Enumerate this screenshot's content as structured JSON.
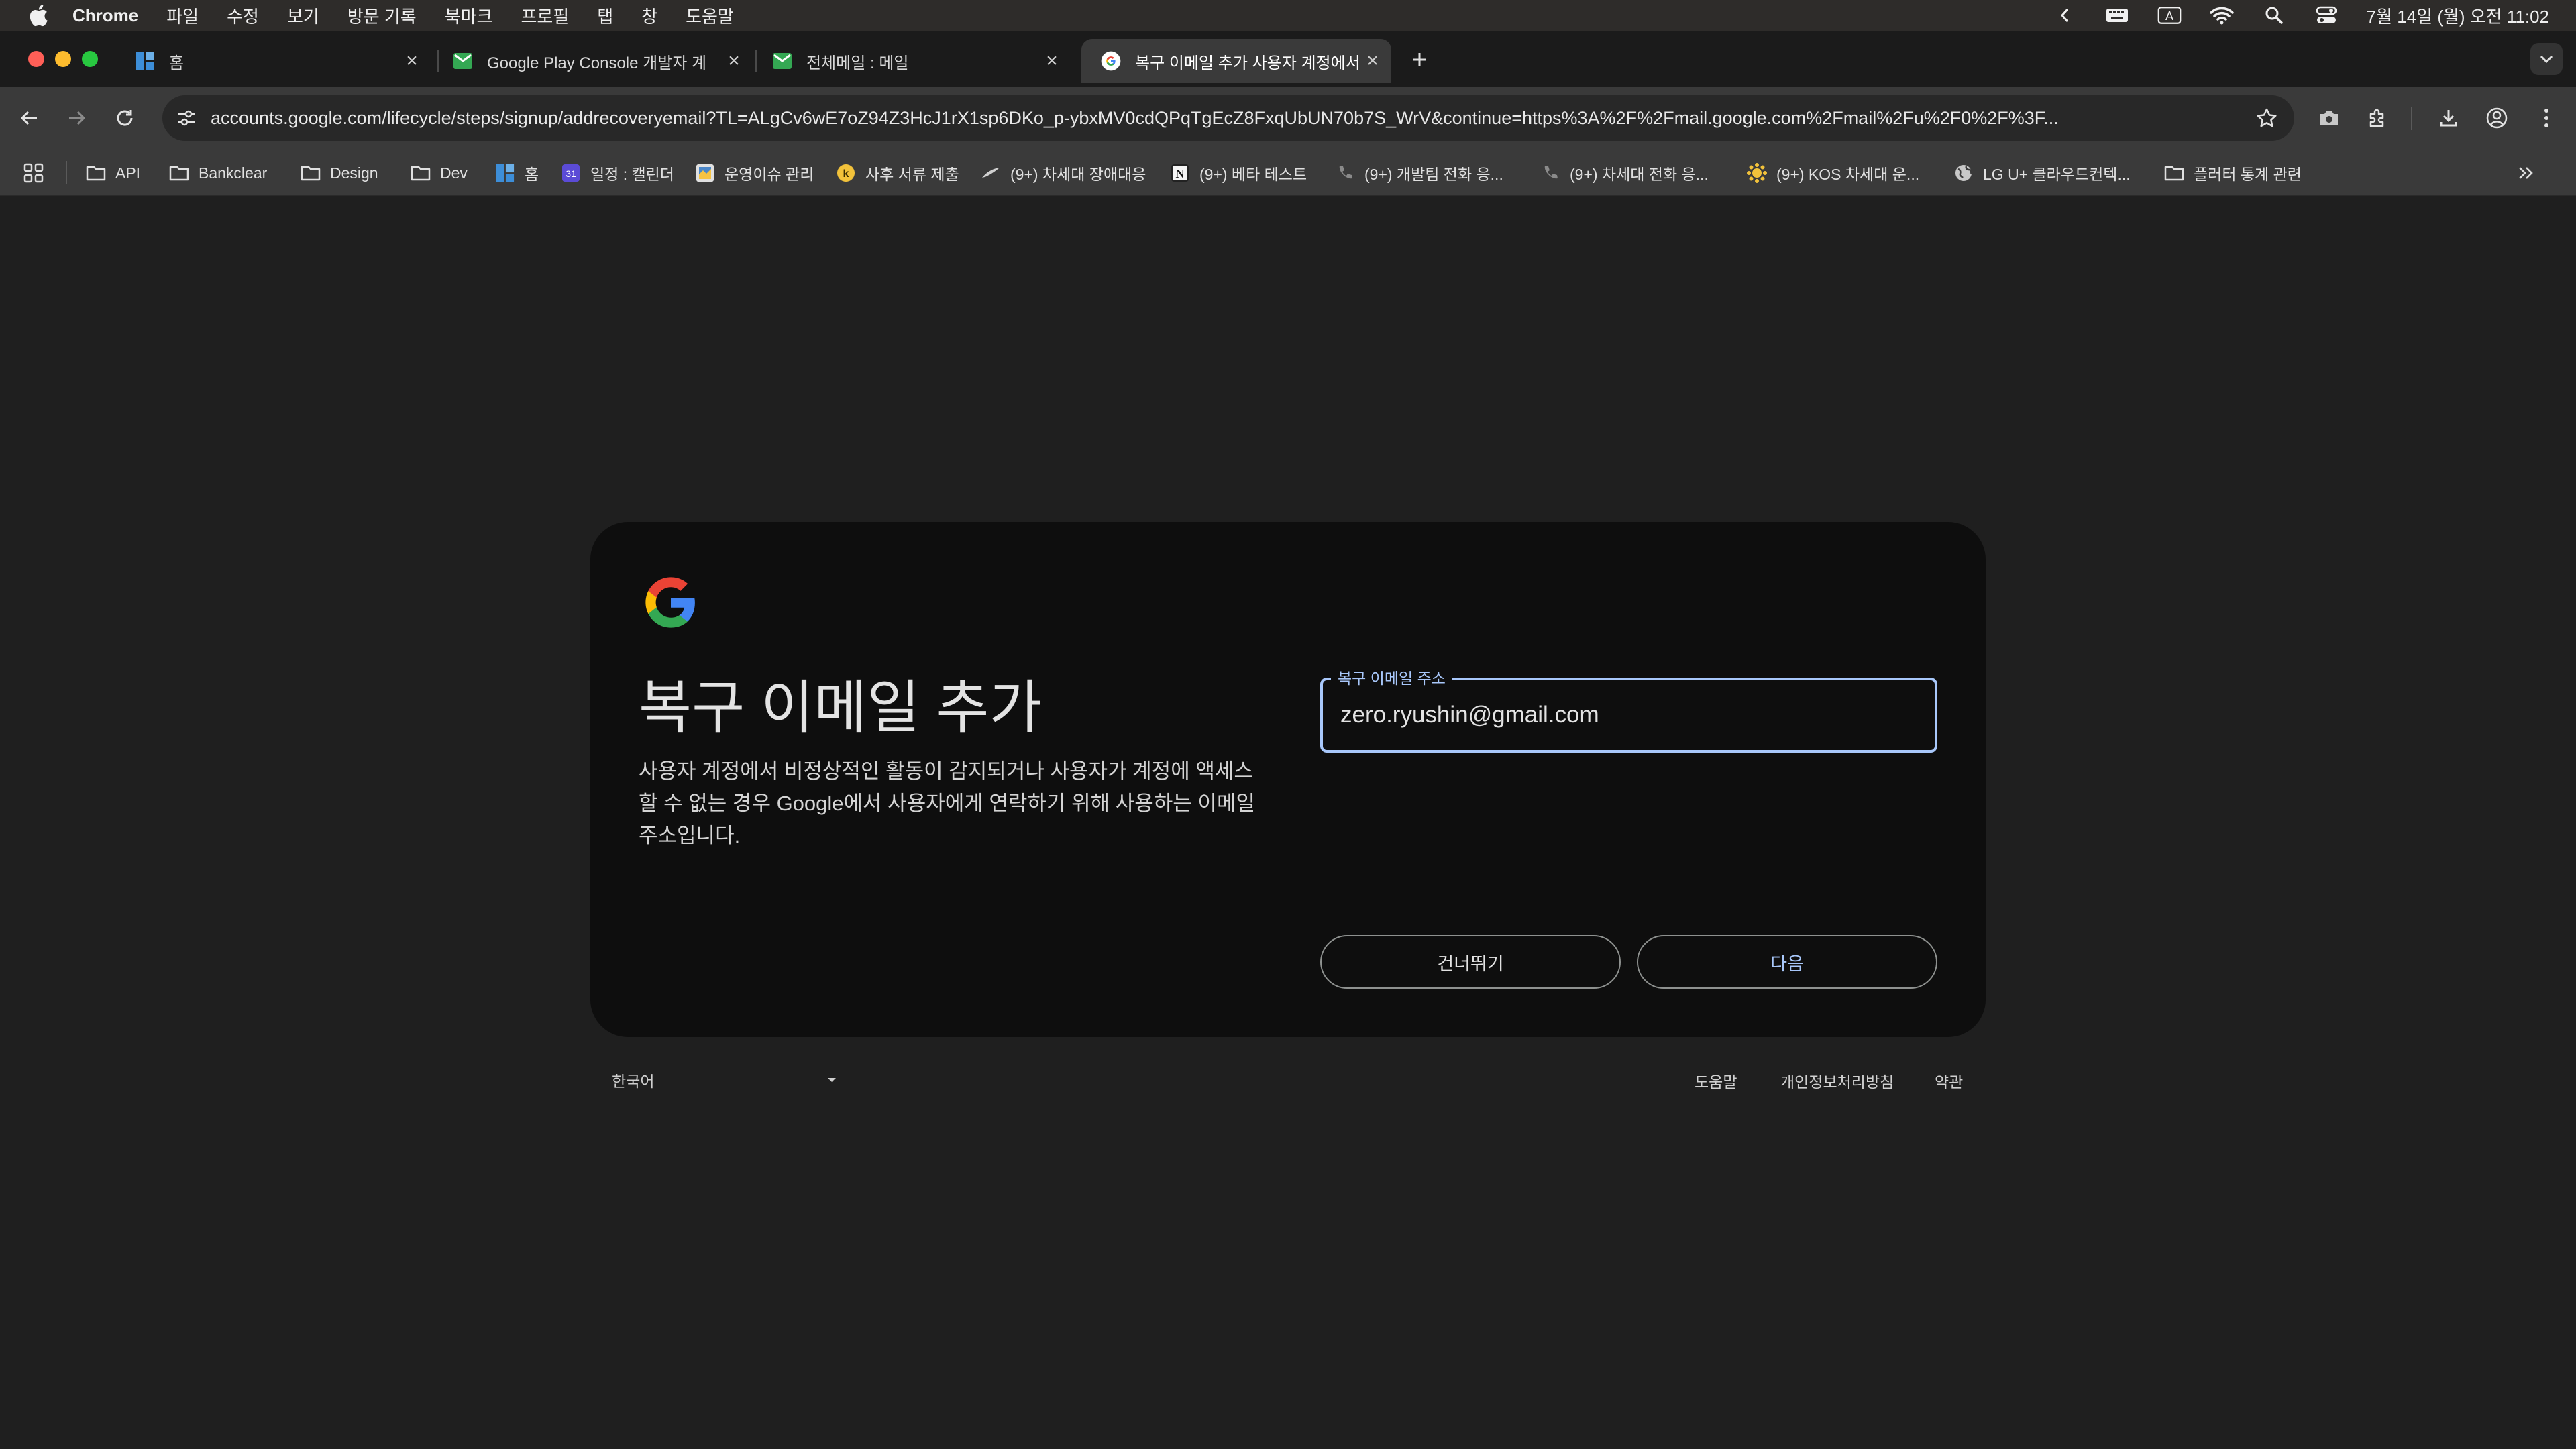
{
  "menubar": {
    "apple_icon": "apple-icon",
    "items": [
      "Chrome",
      "파일",
      "수정",
      "보기",
      "방문 기록",
      "북마크",
      "프로필",
      "탭",
      "창",
      "도움말"
    ],
    "clock": "7월 14일 (월) 오전 11:02",
    "status_icons": [
      "chevron-left-icon",
      "keyboard-icon",
      "input-source-icon",
      "wifi-icon",
      "spotlight-search-icon",
      "control-center-icon"
    ],
    "input_source_letter": "A"
  },
  "tabs": [
    {
      "title": "홈",
      "icon": "notion-home-icon"
    },
    {
      "title": "Google Play Console 개발자 계",
      "icon": "gmail-icon"
    },
    {
      "title": "전체메일 : 메일",
      "icon": "gmail-icon"
    },
    {
      "title": "복구 이메일 추가 사용자 계정에서 I",
      "icon": "google-icon",
      "active": true
    }
  ],
  "toolbar": {
    "url": "accounts.google.com/lifecycle/steps/signup/addrecoveryemail?TL=ALgCv6wE7oZ94Z3HcJ1rX1sp6DKo_p-ybxMV0cdQPqTgEcZ8FxqUbUN70b7S_WrV&continue=https%3A%2F%2Fmail.google.com%2Fmail%2Fu%2F0%2F%3F..."
  },
  "bookmarks": [
    {
      "label": "API",
      "icon": "folder-icon"
    },
    {
      "label": "Bankclear",
      "icon": "folder-icon"
    },
    {
      "label": "Design",
      "icon": "folder-icon"
    },
    {
      "label": "Dev",
      "icon": "folder-icon"
    },
    {
      "label": "홈",
      "icon": "notion-home-icon"
    },
    {
      "label": "일정 : 캘린더",
      "icon": "calendar-icon",
      "icon_text": "31"
    },
    {
      "label": "운영이슈 관리",
      "icon": "sheet-icon"
    },
    {
      "label": "사후 서류 제출",
      "icon": "kakao-icon"
    },
    {
      "label": "(9+) 차세대 장애대응",
      "icon": "swoosh-icon"
    },
    {
      "label": "(9+) 베타 테스트",
      "icon": "notion-icon"
    },
    {
      "label": "(9+) 개발팀 전화 응...",
      "icon": "phone-icon"
    },
    {
      "label": "(9+) 차세대 전화 응...",
      "icon": "phone-icon"
    },
    {
      "label": "(9+) KOS 차세대 운...",
      "icon": "sun-icon"
    },
    {
      "label": "LG U+ 클라우드컨텍...",
      "icon": "globe-icon"
    },
    {
      "label": "플러터 통계 관련",
      "icon": "folder-icon"
    }
  ],
  "page": {
    "heading": "복구 이메일 추가",
    "description": "사용자 계정에서 비정상적인 활동이 감지되거나 사용자가 계정에 액세스할 수 없는 경우 Google에서 사용자에게 연락하기 위해 사용하는 이메일 주소입니다.",
    "field_label": "복구 이메일 주소",
    "field_value": "zero.ryushin@gmail.com",
    "skip_label": "건너뛰기",
    "next_label": "다음",
    "language": "한국어",
    "footer_links": [
      "도움말",
      "개인정보처리방침",
      "약관"
    ]
  },
  "colors": {
    "accent": "#a8c7fa",
    "card_bg": "#0e0e0e",
    "page_bg": "#1f1f1f"
  }
}
